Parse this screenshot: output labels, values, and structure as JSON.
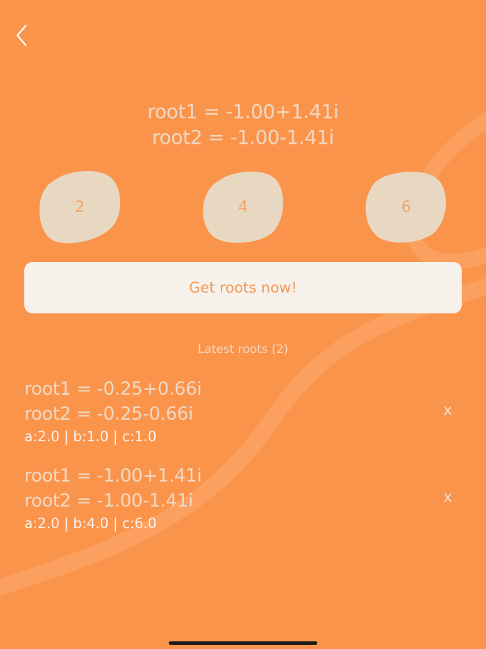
{
  "colors": {
    "background": "#fb944b",
    "blob_fill": "#e8d8c2",
    "button_fill": "#f7f1ec",
    "accent_text": "#f39a58"
  },
  "header": {
    "back_icon": "chevron-left-icon"
  },
  "result": {
    "root1": "root1 = -1.00+1.41i",
    "root2": "root2 = -1.00-1.41i"
  },
  "coefficients": {
    "a": "2",
    "b": "4",
    "c": "6"
  },
  "action": {
    "label": "Get roots now!"
  },
  "history": {
    "title": "Latest roots (2)",
    "delete_label": "x",
    "items": [
      {
        "root1": "root1 = -0.25+0.66i",
        "root2": "root2 = -0.25-0.66i",
        "coefs": "a:2.0 | b:1.0 | c:1.0"
      },
      {
        "root1": "root1 = -1.00+1.41i",
        "root2": "root2 = -1.00-1.41i",
        "coefs": "a:2.0 | b:4.0 | c:6.0"
      }
    ]
  }
}
